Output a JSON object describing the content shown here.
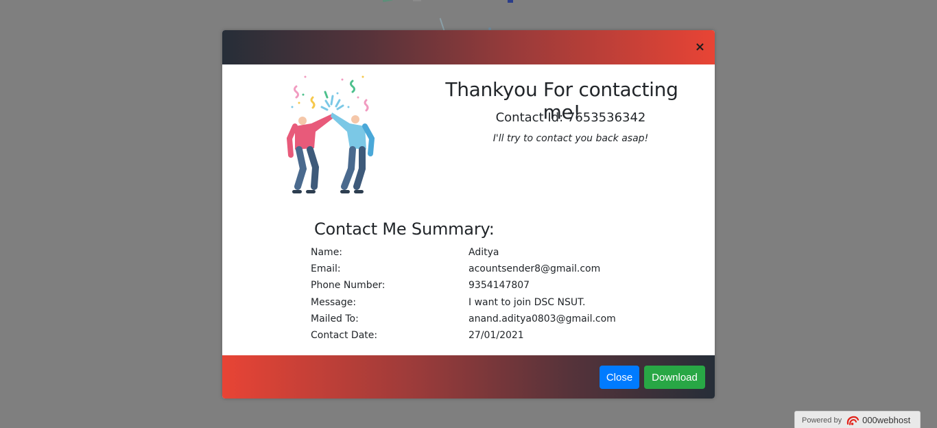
{
  "modal": {
    "close_symbol": "×",
    "title": "Thankyou For contacting me!",
    "contact_id_line": "Contact Id: 7653536342",
    "subtitle": "I'll try to contact you back asap!",
    "illustration_icon": "high-five-celebration-icon",
    "summary": {
      "title": "Contact Me Summary:",
      "rows": [
        {
          "label": "Name:",
          "value": "Aditya"
        },
        {
          "label": "Email:",
          "value": "acountsender8@gmail.com"
        },
        {
          "label": "Phone Number:",
          "value": "9354147807"
        },
        {
          "label": "Message:",
          "value": "I want to join DSC NSUT."
        },
        {
          "label": "Mailed To:",
          "value": "anand.aditya0803@gmail.com"
        },
        {
          "label": "Contact Date:",
          "value": "27/01/2021"
        }
      ]
    },
    "footer": {
      "close_label": "Close",
      "download_label": "Download"
    }
  },
  "badge": {
    "prefix": "Powered by",
    "brand": "000webhost"
  },
  "colors": {
    "overlay": "#7f7f7f",
    "header_dark": "#262e38",
    "header_red": "#e84435",
    "close_button": "#007bff",
    "download_button": "#28a745"
  }
}
